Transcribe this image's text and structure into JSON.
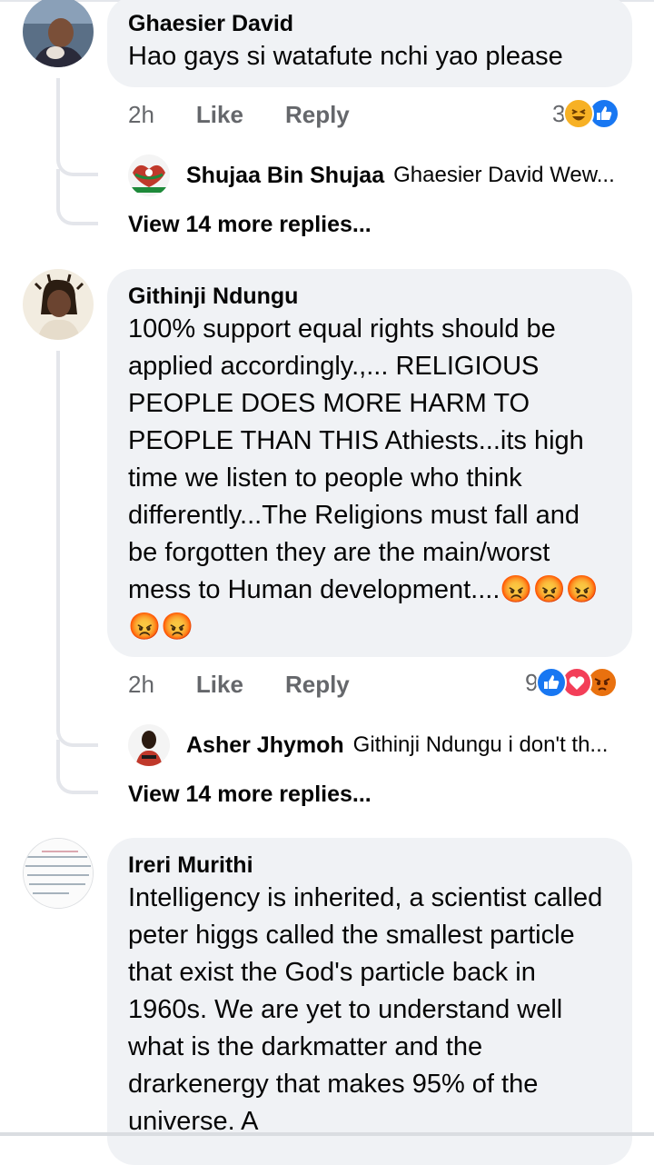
{
  "comments": [
    {
      "author": "Ghaesier David",
      "text": "Hao gays si watafute nchi yao please",
      "time": "2h",
      "like_label": "Like",
      "reply_label": "Reply",
      "reaction_count": "3",
      "reactions": [
        "haha-icon",
        "like-icon"
      ],
      "reply_preview": {
        "author": "Shujaa Bin Shujaa",
        "text": "Ghaesier David Wew..."
      },
      "more_replies": "View 14 more replies..."
    },
    {
      "author": "Githinji Ndungu",
      "text": "100% support equal rights should be applied accordingly.,... RELIGIOUS PEOPLE DOES MORE HARM TO PEOPLE THAN THIS Athiests...its high time we listen to people who think differently...The Religions must fall and be forgotten they are the main/worst mess to Human development....😡😡😡😡😡",
      "time": "2h",
      "like_label": "Like",
      "reply_label": "Reply",
      "reaction_count": "9",
      "reactions": [
        "like-icon",
        "love-icon",
        "angry-icon"
      ],
      "reply_preview": {
        "author": "Asher Jhymoh",
        "text": "Githinji Ndungu i don't th..."
      },
      "more_replies": "View 14 more replies..."
    },
    {
      "author": "Ireri Murithi",
      "text": "Intelligency is inherited, a scientist called peter higgs called the smallest particle that exist the God's particle back in 1960s. We are yet to understand well what is the darkmatter and the drarkenergy that makes 95% of the universe. A"
    }
  ],
  "colors": {
    "like": "#1877f2",
    "love": "#f33e58",
    "haha": "#f7b125",
    "angry": "#e9710f"
  }
}
